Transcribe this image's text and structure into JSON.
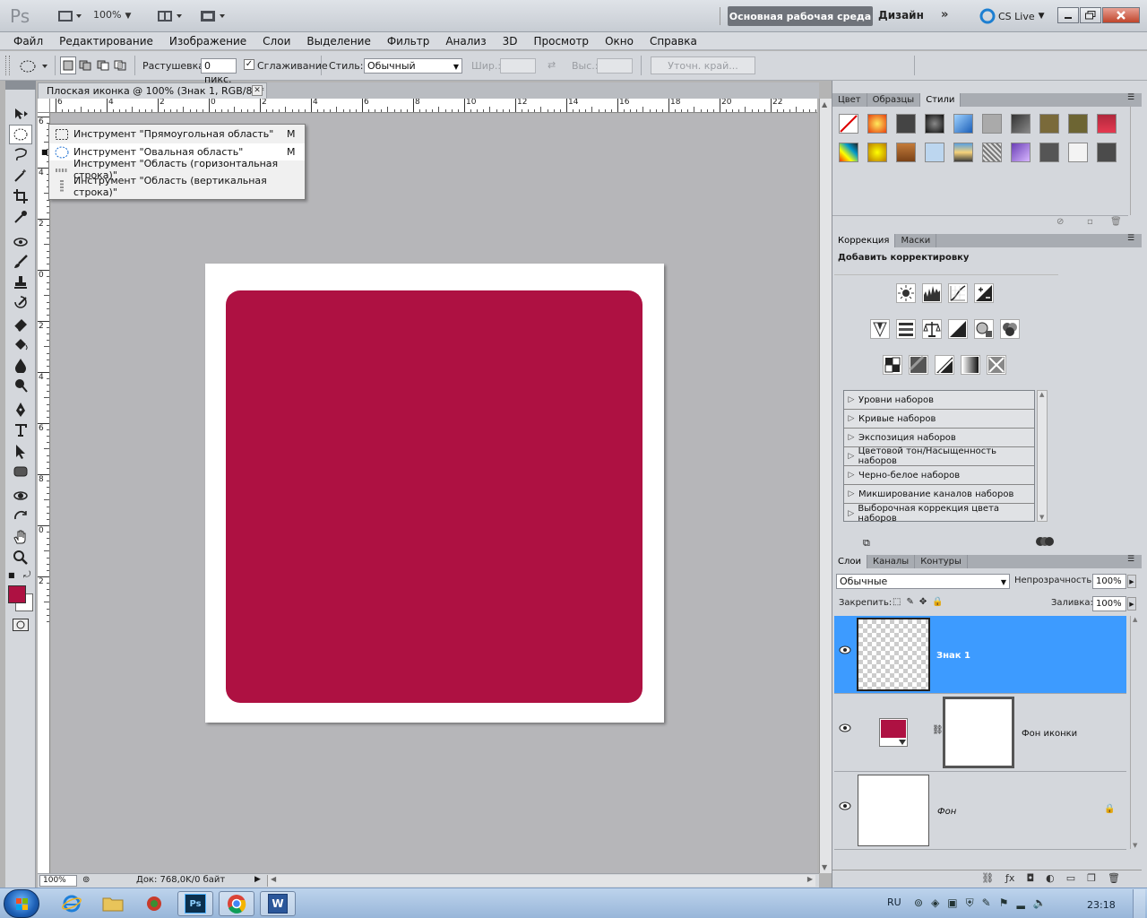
{
  "app": {
    "logo": "Ps",
    "zoom": "100%",
    "workspace_active": "Основная рабочая среда",
    "workspace_alt": "Дизайн",
    "workspace_more": "»",
    "cs_live": "CS Live"
  },
  "menu": [
    "Файл",
    "Редактирование",
    "Изображение",
    "Слои",
    "Выделение",
    "Фильтр",
    "Анализ",
    "3D",
    "Просмотр",
    "Окно",
    "Справка"
  ],
  "options": {
    "feather_label": "Растушевка:",
    "feather_value": "0 пикс.",
    "antialias_label": "Сглаживание",
    "style_label": "Стиль:",
    "style_value": "Обычный",
    "width_label": "Шир.:",
    "height_label": "Выс.:",
    "refine_edge": "Уточн. край..."
  },
  "document": {
    "tab_title": "Плоская иконка @ 100% (Знак 1, RGB/8) *",
    "shape_color": "#ae1142"
  },
  "ruler": {
    "h_ticks": [
      "6",
      "4",
      "2",
      "0",
      "2",
      "4",
      "6",
      "8",
      "10",
      "12",
      "14",
      "16",
      "18",
      "20",
      "22"
    ],
    "v_ticks": [
      "6",
      "4",
      "2",
      "0",
      "2",
      "4",
      "6",
      "8",
      "0",
      "2"
    ]
  },
  "flyout": [
    {
      "label": "Инструмент \"Прямоугольная область\"",
      "key": "M",
      "active": false
    },
    {
      "label": "Инструмент \"Овальная область\"",
      "key": "M",
      "active": true
    },
    {
      "label": "Инструмент \"Область (горизонтальная строка)\"",
      "key": "",
      "active": false
    },
    {
      "label": "Инструмент \"Область (вертикальная строка)\"",
      "key": "",
      "active": false
    }
  ],
  "status": {
    "zoom": "100%",
    "doc": "Док: 768,0K/0 байт"
  },
  "panels": {
    "swatch_tabs": [
      "Цвет",
      "Образцы",
      "Стили"
    ],
    "adjust_tabs": [
      "Коррекция",
      "Маски"
    ],
    "adjust_title": "Добавить корректировку",
    "presets": [
      "Уровни наборов",
      "Кривые наборов",
      "Экспозиция наборов",
      "Цветовой тон/Насыщенность наборов",
      "Черно-белое наборов",
      "Микширование каналов наборов",
      "Выборочная коррекция цвета наборов"
    ],
    "layers_tabs": [
      "Слои",
      "Каналы",
      "Контуры"
    ],
    "blend_mode": "Обычные",
    "opacity_label": "Непрозрачность:",
    "opacity_value": "100%",
    "lock_label": "Закрепить:",
    "fill_label": "Заливка:",
    "fill_value": "100%",
    "layers": [
      "Знак 1",
      "Фон иконки",
      "Фон"
    ]
  },
  "taskbar": {
    "lang": "RU",
    "time": "23:18"
  },
  "colors": {
    "foreground": "#ae1142",
    "selection": "#3d9bff"
  }
}
